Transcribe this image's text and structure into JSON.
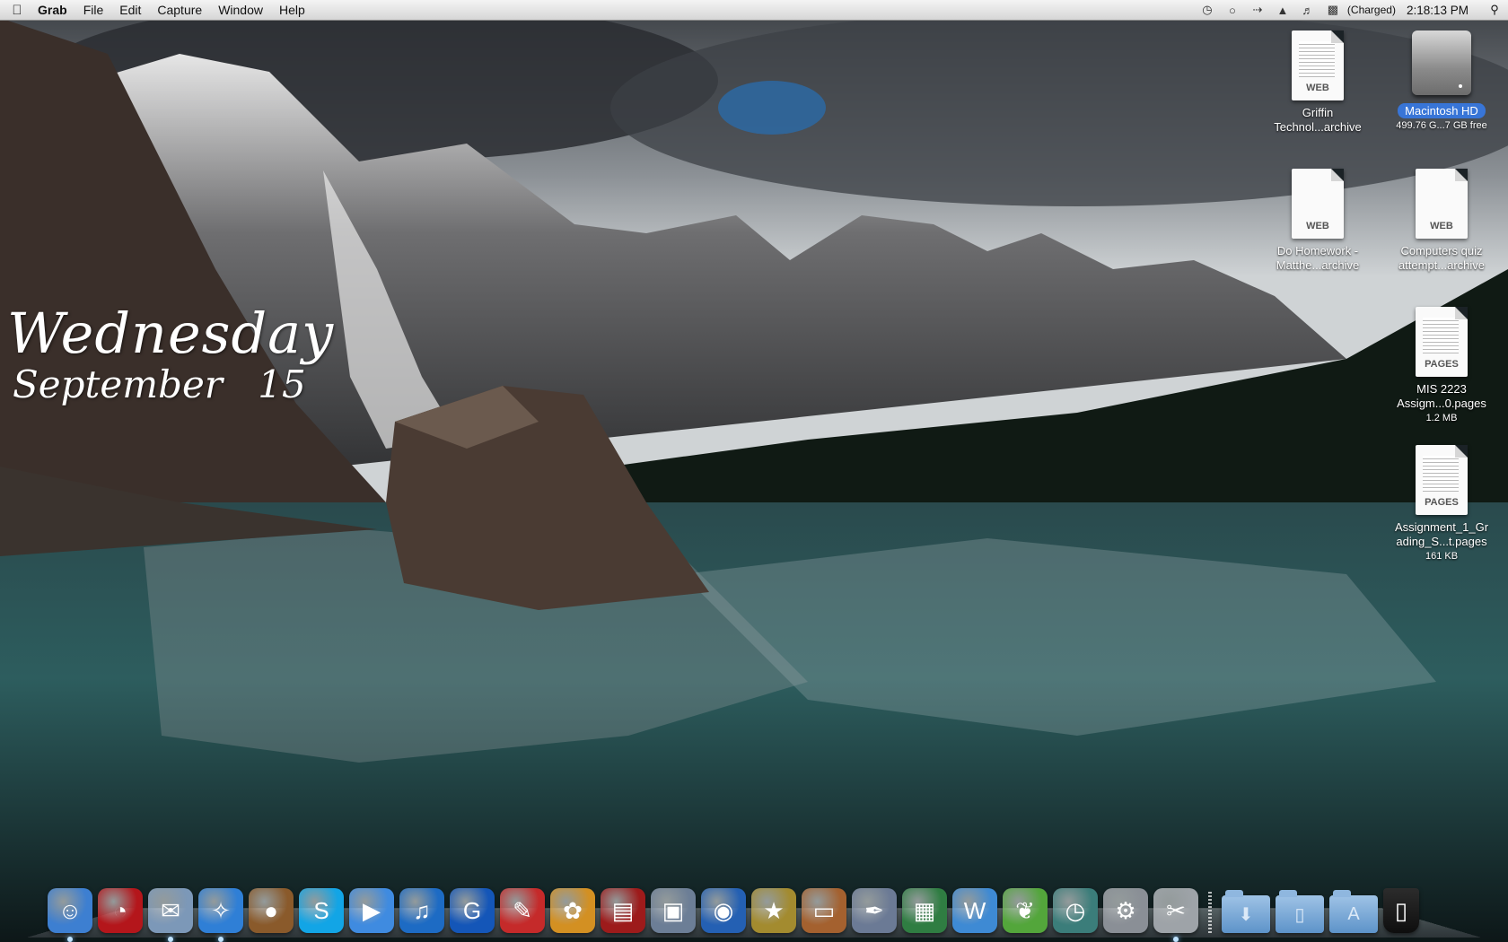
{
  "menubar": {
    "apple_icon": "apple-logo",
    "app_name": "Grab",
    "menus": [
      "File",
      "Edit",
      "Capture",
      "Window",
      "Help"
    ],
    "status_icons": [
      "time-machine-icon",
      "sync-icon",
      "bluetooth-icon",
      "wifi-icon",
      "volume-icon",
      "battery-icon"
    ],
    "battery_text": "(Charged)",
    "clock": "2:18:13 PM",
    "spotlight_icon": "spotlight-icon"
  },
  "date_widget": {
    "weekday": "Wednesday",
    "month": "September",
    "day": "15"
  },
  "desktop_icons": [
    {
      "name_line1": "Griffin",
      "name_line2": "Technol...archive",
      "badge": "WEB",
      "type": "web-archive"
    },
    {
      "name_line1": "Macintosh HD",
      "name_line2": "499.76 G...7 GB free",
      "type": "hard-drive",
      "selected": true
    },
    {
      "name_line1": "Do Homework -",
      "name_line2": "Matthe...archive",
      "badge": "WEB",
      "type": "web-archive"
    },
    {
      "name_line1": "Computers quiz",
      "name_line2": "attempt...archive",
      "badge": "WEB",
      "type": "web-archive"
    },
    {
      "name_line1": "MIS 2223",
      "name_line2": "Assigm...0.pages",
      "name_line3": "1.2 MB",
      "badge": "PAGES",
      "type": "pages"
    },
    {
      "name_line1": "Assignment_1_Gr",
      "name_line2": "ading_S...t.pages",
      "name_line3": "161 KB",
      "badge": "PAGES",
      "type": "pages"
    }
  ],
  "dock": {
    "apps": [
      {
        "icon": "finder-icon",
        "glyph": "☺",
        "color": "#3d7fd1",
        "running": true
      },
      {
        "icon": "dashboard-icon",
        "glyph": "◔",
        "color": "#b4161b",
        "running": false
      },
      {
        "icon": "mail-icon",
        "glyph": "✉",
        "color": "#7c98b8",
        "running": true
      },
      {
        "icon": "safari-icon",
        "glyph": "✧",
        "color": "#2f7fd6",
        "running": true
      },
      {
        "icon": "coconut-battery-icon",
        "glyph": "●",
        "color": "#8a5a2b",
        "running": false
      },
      {
        "icon": "skype-icon",
        "glyph": "S",
        "color": "#12a5e6",
        "running": false
      },
      {
        "icon": "ichat-icon",
        "glyph": "▶",
        "color": "#3f8be0",
        "running": false
      },
      {
        "icon": "itunes-icon",
        "glyph": "♫",
        "color": "#1d6bc4",
        "running": false
      },
      {
        "icon": "google-earth-icon",
        "glyph": "G",
        "color": "#1456b8",
        "running": false
      },
      {
        "icon": "pixelmator-icon",
        "glyph": "✎",
        "color": "#c52a2a",
        "running": false
      },
      {
        "icon": "adium-icon",
        "glyph": "✿",
        "color": "#d39022",
        "running": false
      },
      {
        "icon": "front-row-icon",
        "glyph": "▤",
        "color": "#9d1b1b",
        "running": false
      },
      {
        "icon": "iphoto-icon",
        "glyph": "▣",
        "color": "#6c7e96",
        "running": false
      },
      {
        "icon": "dvd-player-icon",
        "glyph": "◉",
        "color": "#2460b3",
        "running": false
      },
      {
        "icon": "imovie-icon",
        "glyph": "★",
        "color": "#a38b2f",
        "running": false
      },
      {
        "icon": "keynote-icon",
        "glyph": "▭",
        "color": "#a4612f",
        "running": false
      },
      {
        "icon": "script-editor-icon",
        "glyph": "✒",
        "color": "#6b7a95",
        "running": false
      },
      {
        "icon": "numbers-icon",
        "glyph": "▦",
        "color": "#2f7d42",
        "running": false
      },
      {
        "icon": "word-icon",
        "glyph": "W",
        "color": "#3e8ad4",
        "running": false
      },
      {
        "icon": "evernote-icon",
        "glyph": "❦",
        "color": "#53a63b",
        "running": false
      },
      {
        "icon": "time-machine-icon",
        "glyph": "◷",
        "color": "#3b7d7a",
        "running": false
      },
      {
        "icon": "system-preferences-icon",
        "glyph": "⚙",
        "color": "#8a8f96",
        "running": false
      },
      {
        "icon": "grab-icon",
        "glyph": "✂",
        "color": "#9ea3a8",
        "running": true
      }
    ],
    "folders": [
      {
        "icon": "downloads-folder-icon",
        "glyph": "⬇"
      },
      {
        "icon": "documents-folder-icon",
        "glyph": "▯"
      },
      {
        "icon": "applications-folder-icon",
        "glyph": "A"
      }
    ],
    "trash_icon": "trash-icon"
  }
}
